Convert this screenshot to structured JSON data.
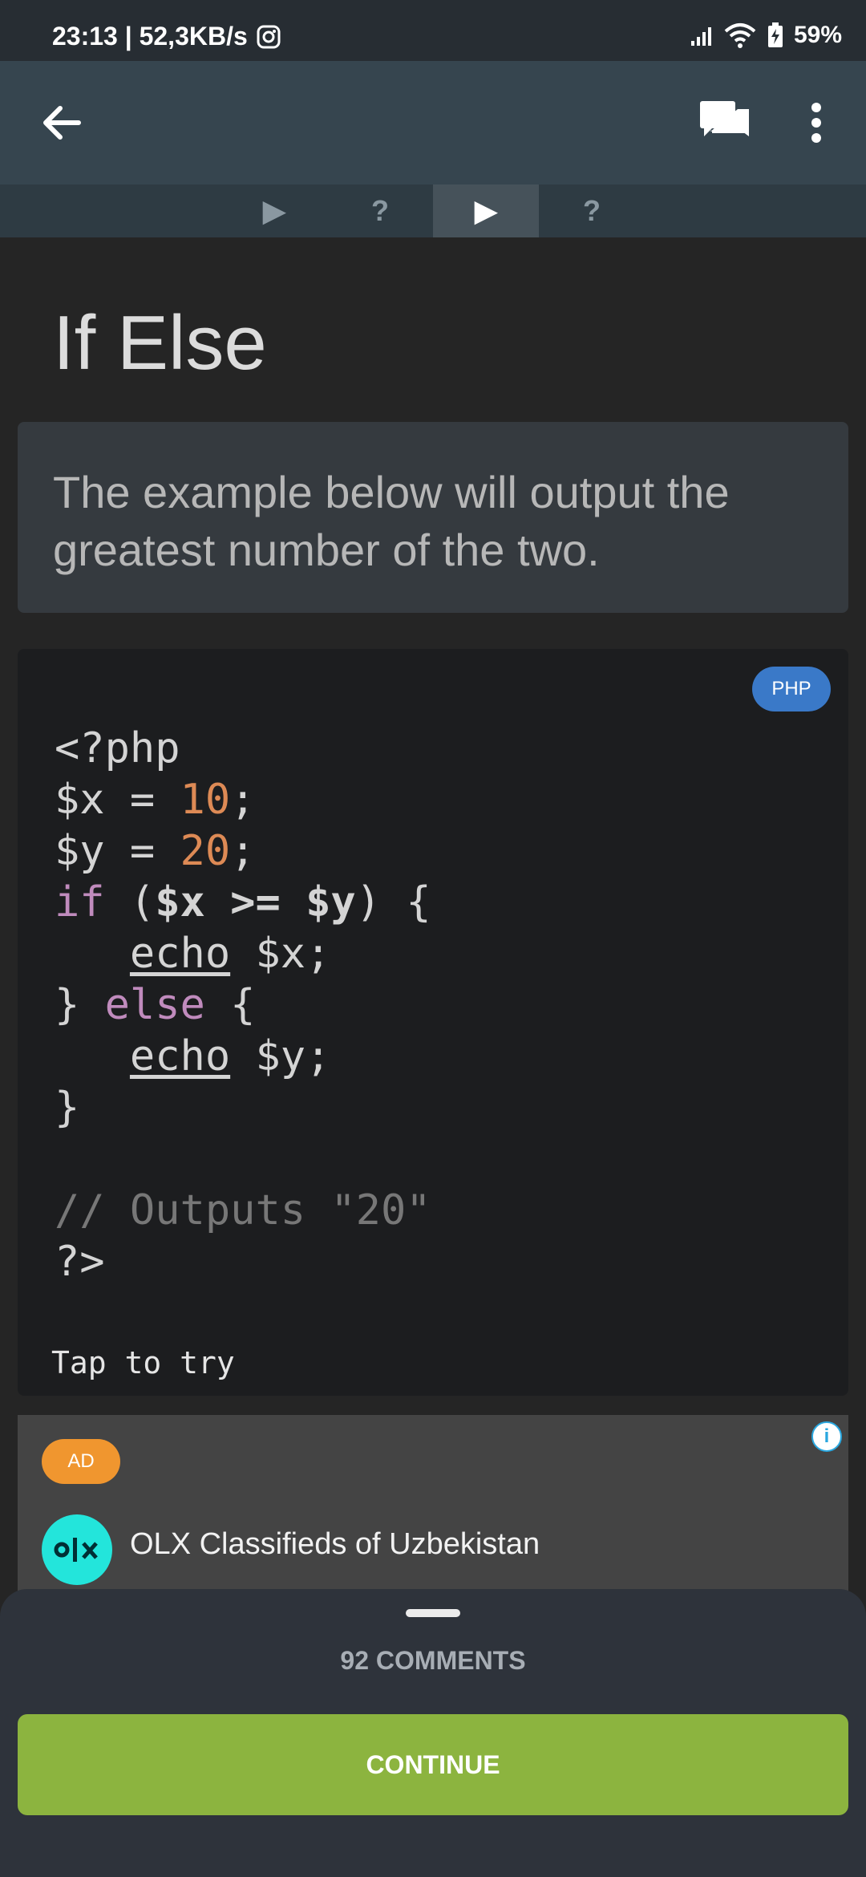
{
  "status_bar": {
    "time_speed": "23:13 | 52,3KB/s",
    "battery": "59%",
    "icons": [
      "instagram-icon",
      "signal-icon",
      "wifi-icon",
      "battery-icon"
    ]
  },
  "toolbar": {
    "back_icon": "arrow-left-icon",
    "comments_icon": "chat-bubbles-icon",
    "menu_icon": "more-vert-icon"
  },
  "lesson_tabs": [
    {
      "label": "▶",
      "type": "play"
    },
    {
      "label": "?",
      "type": "quiz"
    },
    {
      "label": "▶",
      "type": "play",
      "active": true
    },
    {
      "label": "?",
      "type": "quiz"
    }
  ],
  "page": {
    "title": "If Else",
    "intro": "The example below will output the greatest number of the two."
  },
  "code": {
    "language": "PHP",
    "lines": [
      "<?php",
      "$x = 10;",
      "$y = 20;",
      "if ($x >= $y) {",
      "   echo $x;",
      "} else {",
      "   echo $y;",
      "}",
      "",
      "// Outputs \"20\"",
      "?>"
    ],
    "tap_to_try": "Tap to try"
  },
  "ad": {
    "badge": "AD",
    "info_icon": "info-icon",
    "logo": "olx",
    "title": "OLX Classifieds of Uzbekistan"
  },
  "bottom_sheet": {
    "comments": "92 COMMENTS",
    "continue": "CONTINUE"
  },
  "colors": {
    "app_bar": "#36454f",
    "badge_blue": "#3a79c8",
    "ad_orange": "#f0962f",
    "continue_green": "#8cb43f",
    "keyword": "#c08bbd",
    "number": "#dd8a55"
  }
}
